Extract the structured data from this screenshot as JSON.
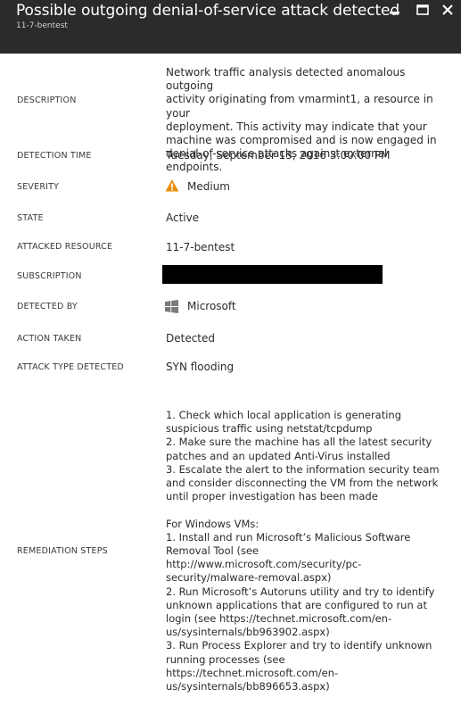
{
  "window": {
    "title": "Possible outgoing denial-of-service attack detected",
    "subtitle": "11-7-bentest"
  },
  "fields": {
    "description": {
      "label": "DESCRIPTION",
      "value": "Network traffic analysis detected anomalous outgoing\nactivity originating from vmarmint1, a resource in your\ndeployment. This activity may indicate that your\nmachine was compromised and is now engaged in\ndenial-of-service attacks against external endpoints."
    },
    "detection_time": {
      "label": "DETECTION TIME",
      "value": "Tuesday, September 13, 2016 3:00:00 PM"
    },
    "severity": {
      "label": "SEVERITY",
      "value": "Medium",
      "icon": "warning-icon",
      "icon_color": "#e8900c"
    },
    "state": {
      "label": "STATE",
      "value": "Active"
    },
    "attacked_resource": {
      "label": "ATTACKED RESOURCE",
      "value": "11-7-bentest"
    },
    "subscription": {
      "label": "SUBSCRIPTION"
    },
    "detected_by": {
      "label": "DETECTED BY",
      "value": "Microsoft",
      "icon": "windows-logo-icon"
    },
    "action_taken": {
      "label": "ACTION TAKEN",
      "value": "Detected"
    },
    "attack_type": {
      "label": "ATTACK TYPE DETECTED",
      "value": "SYN flooding"
    },
    "remediation": {
      "label": "REMEDIATION STEPS",
      "value": "1. Check which local application is generating\nsuspicious traffic using netstat/tcpdump\n2. Make sure the machine has all the latest security\npatches and an updated Anti-Virus installed\n3. Escalate the alert to the information security team\nand consider disconnecting the VM from the network\nuntil proper investigation has been made\n\nFor Windows VMs:\n1. Install and run Microsoft’s Malicious Software\nRemoval Tool (see\nhttp://www.microsoft.com/security/pc-\nsecurity/malware-removal.aspx)\n2. Run Microsoft’s Autoruns utility and try to identify\nunknown applications that are configured to run at\nlogin (see https://technet.microsoft.com/en-\nus/sysinternals/bb963902.aspx)\n3. Run Process Explorer and try to identify unknown\nrunning processes (see\nhttps://technet.microsoft.com/en-\nus/sysinternals/bb896653.aspx)"
    }
  },
  "colors": {
    "titlebar": "#2b2b2b",
    "warning": "#e8900c",
    "text": "#2b2b2b"
  }
}
